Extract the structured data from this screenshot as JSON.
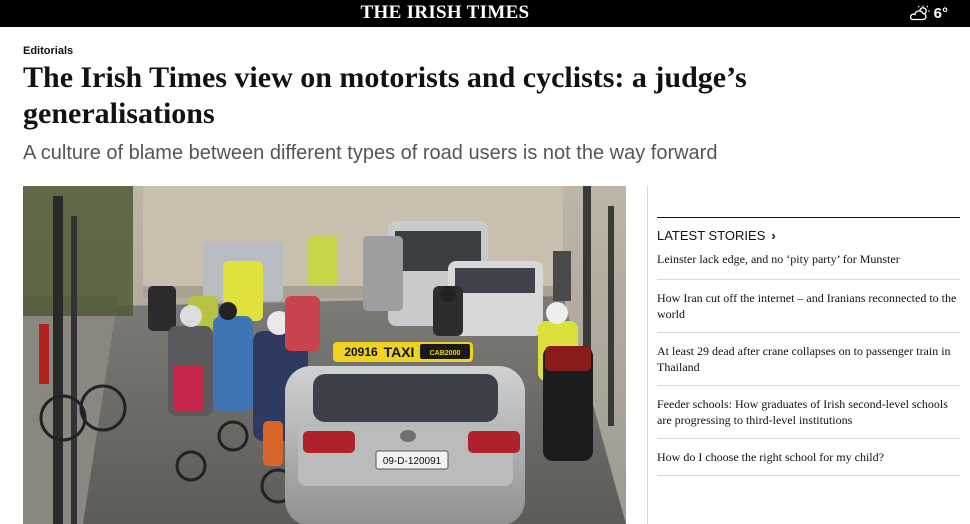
{
  "masthead": {
    "title": "THE IRISH TIMES"
  },
  "weather": {
    "icon": "partly-cloudy-icon",
    "temperature": "6°"
  },
  "article": {
    "section": "Editorials",
    "headline_line1": "The Irish Times view on motorists and cyclists: a judge’s",
    "headline_line2": "generalisations",
    "standfirst": "A culture of blame between different types of road users is not the way forward"
  },
  "photo": {
    "taxi_sign_number": "20916",
    "taxi_sign_word": "TAXI",
    "taxi_sign_badge": "CAB2000",
    "number_plate": "09-D-120091"
  },
  "latest_stories": {
    "heading": "LATEST STORIES",
    "chevron": "›",
    "items": [
      {
        "title": "Leinster lack edge, and no ‘pity party’ for Munster"
      },
      {
        "title": "How Iran cut off the internet – and Iranians reconnected to the world"
      },
      {
        "title": "At least 29 dead after crane collapses on to passenger train in Thailand"
      },
      {
        "title": "Feeder schools: How graduates of Irish second-level schools are progressing to third-level institutions"
      },
      {
        "title": "How do I choose the right school for my child?"
      }
    ]
  }
}
